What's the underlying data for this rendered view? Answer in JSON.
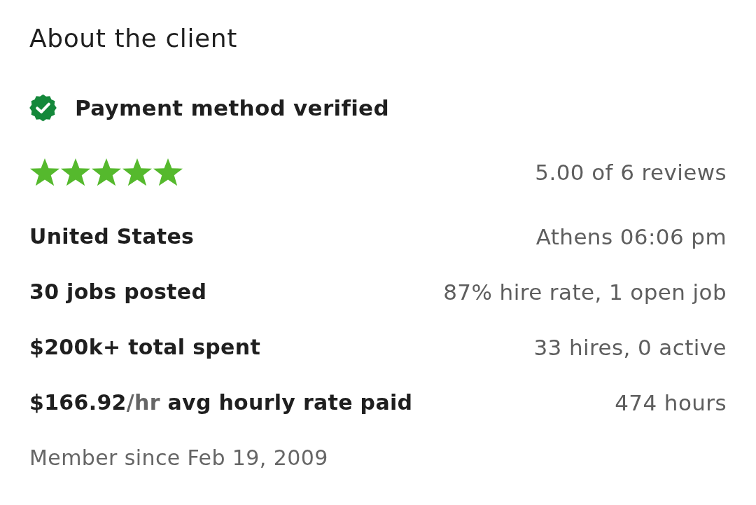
{
  "title": "About the client",
  "payment": {
    "label": "Payment method verified",
    "verified": true
  },
  "rating": {
    "stars": 5,
    "reading": "5.00 of 6 reviews"
  },
  "rows": [
    {
      "kind": "plain",
      "left": "United States",
      "right": "Athens 06:06 pm"
    },
    {
      "kind": "plain",
      "left": "30 jobs posted",
      "right": "87% hire rate, 1 open job"
    },
    {
      "kind": "plain",
      "left": "$200k+ total spent",
      "right": "33 hires, 0 active"
    },
    {
      "kind": "rate",
      "amount": "$166.92",
      "unit": "/hr",
      "label": "avg hourly rate paid",
      "right": "474 hours"
    }
  ],
  "member_since": "Member since Feb 19, 2009"
}
